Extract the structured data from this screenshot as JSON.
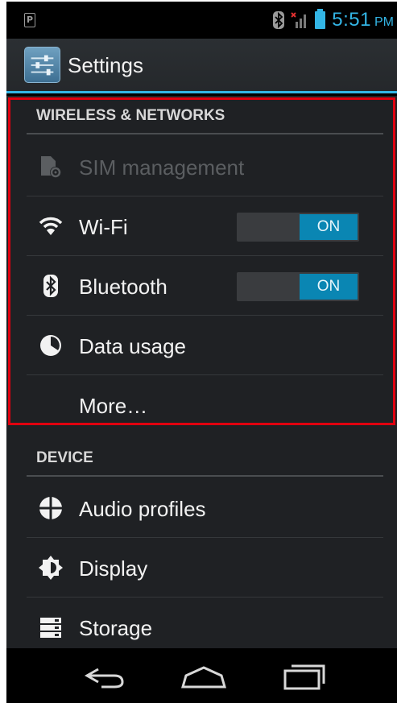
{
  "status_bar": {
    "notification_icon": "p-icon",
    "notification_letter": "P",
    "icons": [
      "bluetooth-icon",
      "signal-no-sim-icon",
      "battery-icon"
    ],
    "time": "5:51",
    "ampm": "PM"
  },
  "action_bar": {
    "icon": "settings-sliders-icon",
    "title": "Settings"
  },
  "sections": {
    "wireless": {
      "header": "WIRELESS & NETWORKS",
      "items": [
        {
          "label": "SIM management",
          "icon": "sim-icon",
          "enabled": false
        },
        {
          "label": "Wi-Fi",
          "icon": "wifi-icon",
          "toggle": "ON"
        },
        {
          "label": "Bluetooth",
          "icon": "bluetooth-icon",
          "toggle": "ON"
        },
        {
          "label": "Data usage",
          "icon": "data-usage-icon"
        },
        {
          "label": "More…"
        }
      ]
    },
    "device": {
      "header": "DEVICE",
      "items": [
        {
          "label": "Audio profiles",
          "icon": "audio-profiles-icon"
        },
        {
          "label": "Display",
          "icon": "display-icon"
        },
        {
          "label": "Storage",
          "icon": "storage-icon"
        }
      ]
    }
  },
  "nav_bar": {
    "buttons": [
      "back-icon",
      "home-icon",
      "recent-apps-icon"
    ]
  },
  "colors": {
    "accent": "#33b5e5",
    "toggle_on": "#0a86b3",
    "highlight_border": "#e0000f",
    "background": "#1f2124"
  }
}
